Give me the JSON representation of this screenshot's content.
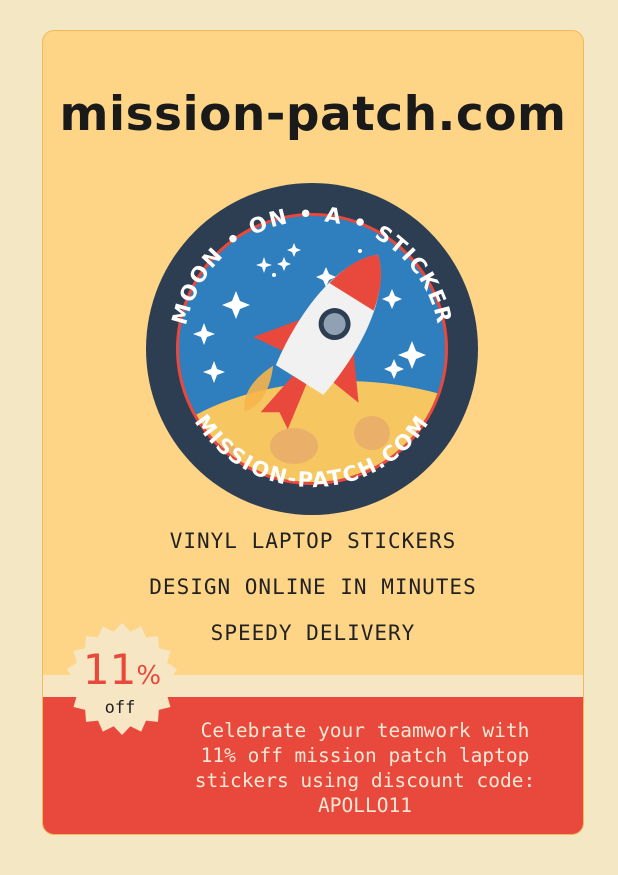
{
  "site": {
    "title": "mission-patch.com"
  },
  "patch": {
    "top_text": "MOON • ON • A • STICKER",
    "bottom_text": "MISSION-PATCH.COM",
    "icon": "rocket-icon",
    "colors": {
      "ring": "#2d3e52",
      "sky": "#2f7fbf",
      "moon": "#f6c660",
      "rocket_fin": "#e8493c",
      "rocket_body": "#f1f1f1"
    }
  },
  "taglines": [
    "VINYL LAPTOP STICKERS",
    "DESIGN ONLINE IN MINUTES",
    "SPEEDY DELIVERY"
  ],
  "badge": {
    "value": "11",
    "unit": "%",
    "label": "off"
  },
  "promo": {
    "text": "Celebrate your teamwork with\n11% off mission patch laptop\nstickers using discount code:\nAPOLLO11"
  },
  "colors": {
    "background": "#f4e7c4",
    "card": "#fed587",
    "promo": "#e8493c",
    "text_dark": "#1a1a1a"
  }
}
